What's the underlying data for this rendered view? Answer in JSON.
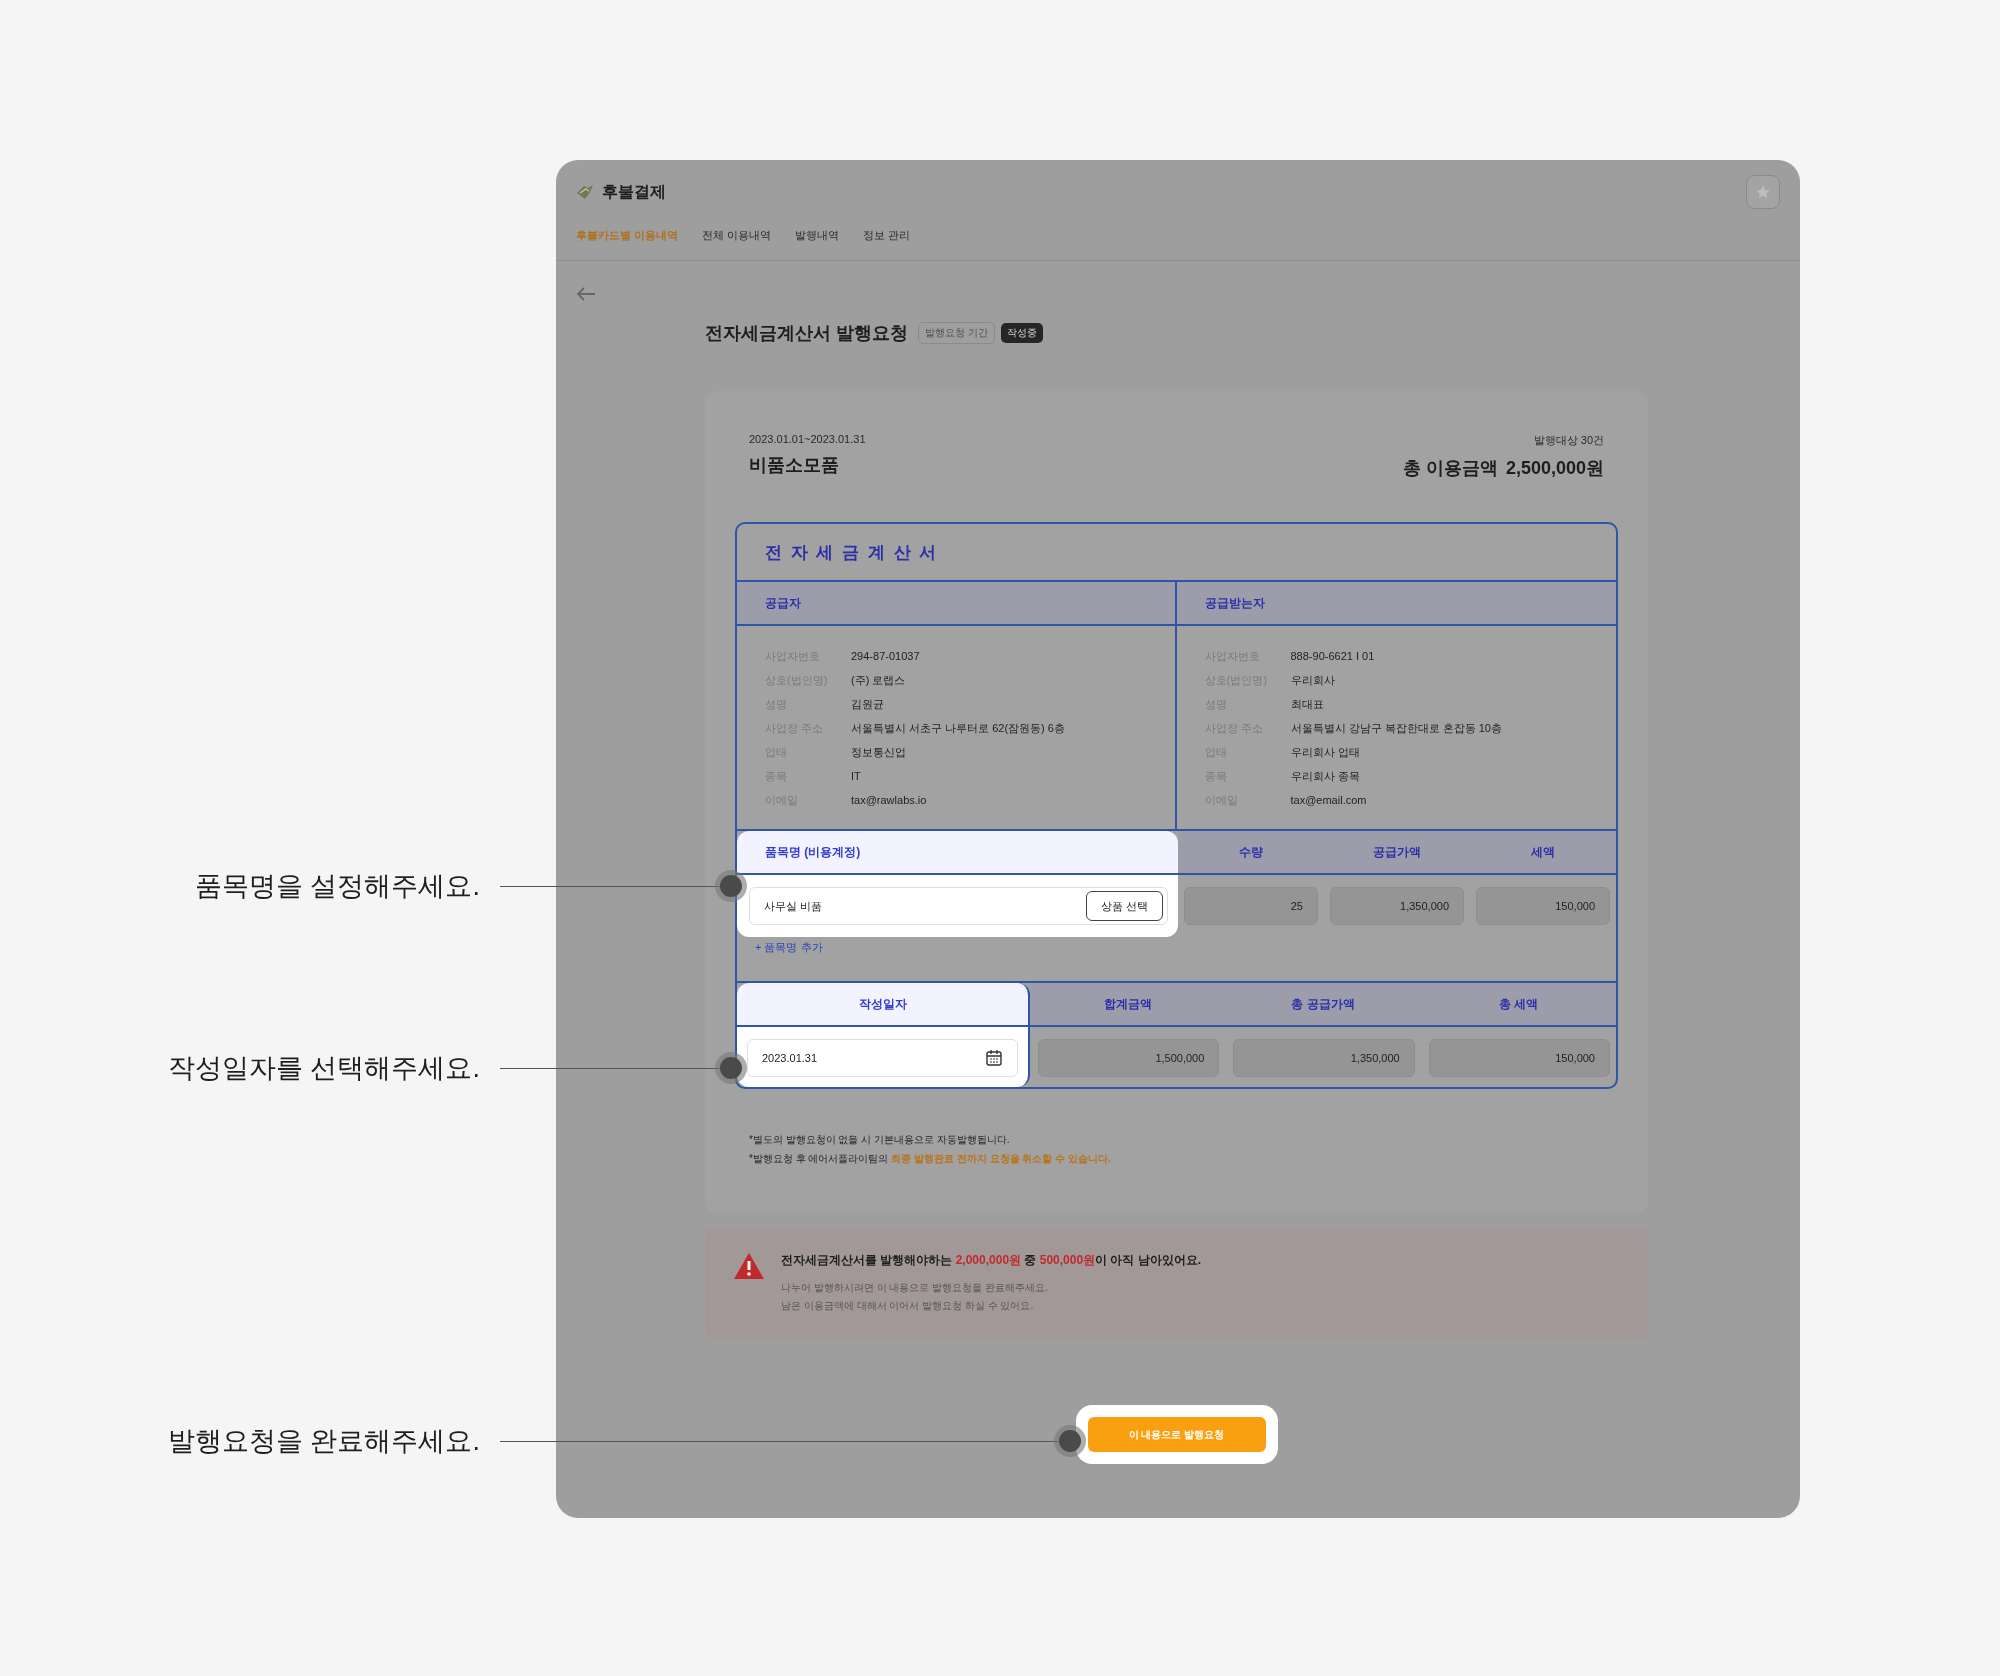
{
  "app": {
    "title": "후불결제"
  },
  "tabs": [
    {
      "label": "후불카드별 이용내역",
      "selected": true
    },
    {
      "label": "전체 이용내역",
      "selected": false
    },
    {
      "label": "발행내역",
      "selected": false
    },
    {
      "label": "정보 관리",
      "selected": false
    }
  ],
  "page": {
    "title": "전자세금계산서 발행요청",
    "badges": [
      {
        "label": "발행요청 기간",
        "kind": "outline"
      },
      {
        "label": "작성중",
        "kind": "dark"
      }
    ]
  },
  "summary": {
    "period": "2023.01.01~2023.01.31",
    "category": "비품소모품",
    "count": "발행대상 30건",
    "total_label": "총 이용금액",
    "total": "2,500,000원"
  },
  "invoice": {
    "title": "전 자 세 금 계 산 서",
    "parties": [
      {
        "heading": "공급자",
        "fields": [
          {
            "label": "사업자번호",
            "value": "294-87-01037"
          },
          {
            "label": "상호(법인명)",
            "value": "(주) 로랩스"
          },
          {
            "label": "성명",
            "value": "김원균"
          },
          {
            "label": "사업장 주소",
            "value": "서울특별시 서초구 나루터로 62(잠원동) 6층"
          },
          {
            "label": "업태",
            "value": "정보통신업"
          },
          {
            "label": "종목",
            "value": "IT"
          },
          {
            "label": "이메일",
            "value": "tax@rawlabs.io"
          }
        ]
      },
      {
        "heading": "공급받는자",
        "fields": [
          {
            "label": "사업자번호",
            "value": "888-90-6621 I 01"
          },
          {
            "label": "상호(법인명)",
            "value": "우리회사"
          },
          {
            "label": "성명",
            "value": "최대표"
          },
          {
            "label": "사업장 주소",
            "value": "서울특별시 강남구 복잡한대로 혼잡동 10층"
          },
          {
            "label": "업태",
            "value": "우리회사 업태"
          },
          {
            "label": "종목",
            "value": "우리회사 종목"
          },
          {
            "label": "이메일",
            "value": "tax@email.com"
          }
        ]
      }
    ],
    "item_columns": [
      "품목명 (비용계정)",
      "수량",
      "공급가액",
      "세액"
    ],
    "items_highlighted": true,
    "items": [
      {
        "name": "사무실 비품",
        "select_button": "상품 선택",
        "quantity": "25",
        "supply": "1,350,000",
        "tax": "150,000"
      }
    ],
    "add_item": "+ 품목명 추가",
    "date_columns": [
      "작성일자",
      "합계금액",
      "총 공급가액",
      "총 세액"
    ],
    "date_highlighted": true,
    "date": "2023.01.31",
    "totals": [
      "1,500,000",
      "1,350,000",
      "150,000"
    ]
  },
  "notes": [
    "*별도의 발행요청이 없을 시 기본내용으로 자동발행됩니다.",
    "*발행요청 후 에어서플라이팀의 **최종 발행완료 전까지 요청을 취소할 수 있습니다.**"
  ],
  "warning": {
    "headline": "전자세금계산서를 발행해야하는 **2,000,000원** 중 **500,000원**이 아직 남아있어요.",
    "lines": [
      "나누어 발행하시려면 이 내용으로 발행요청을 완료해주세요.",
      "남은 이용금액에 대해서 이어서 발행요청 하실 수 있어요."
    ]
  },
  "submit": {
    "label": "이 내용으로 발행요청",
    "highlighted": true
  },
  "annotations": [
    "품목명을 설정해주세요.",
    "작성일자를 선택해주세요.",
    "발행요청을 완료해주세요."
  ]
}
